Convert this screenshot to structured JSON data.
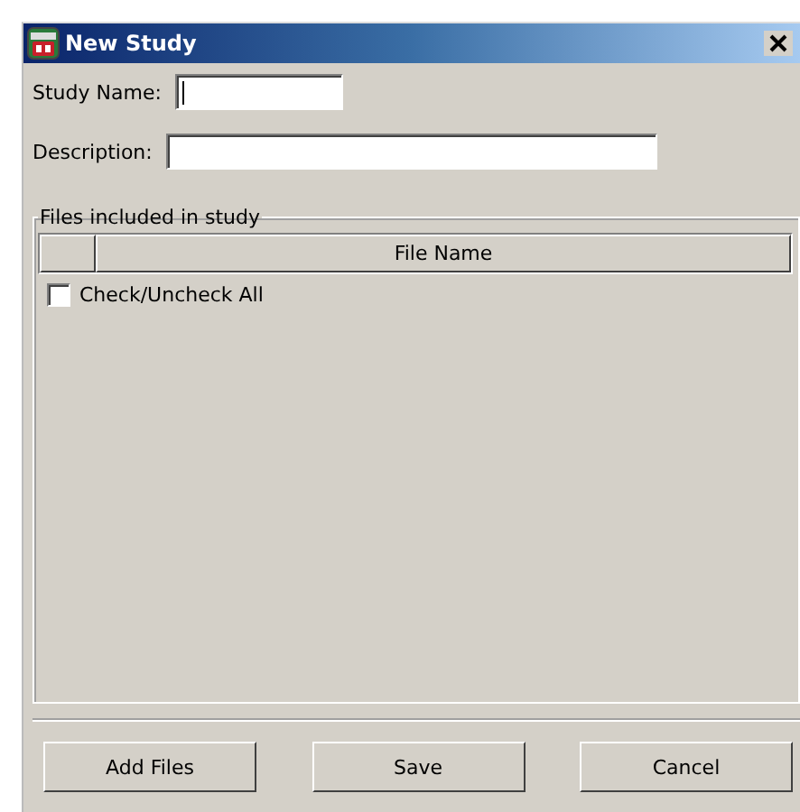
{
  "window": {
    "title": "New Study"
  },
  "fields": [
    {
      "label": "Study Name:",
      "kind": "short"
    },
    {
      "label": "Description:",
      "kind": "long"
    }
  ],
  "group": {
    "title": "Files included in study",
    "table": {
      "columns": [
        "",
        "File Name"
      ]
    },
    "check_all": {
      "label": "Check/Uncheck All",
      "checked": false
    }
  },
  "buttons": [
    "Add Files",
    "Save",
    "Cancel"
  ]
}
